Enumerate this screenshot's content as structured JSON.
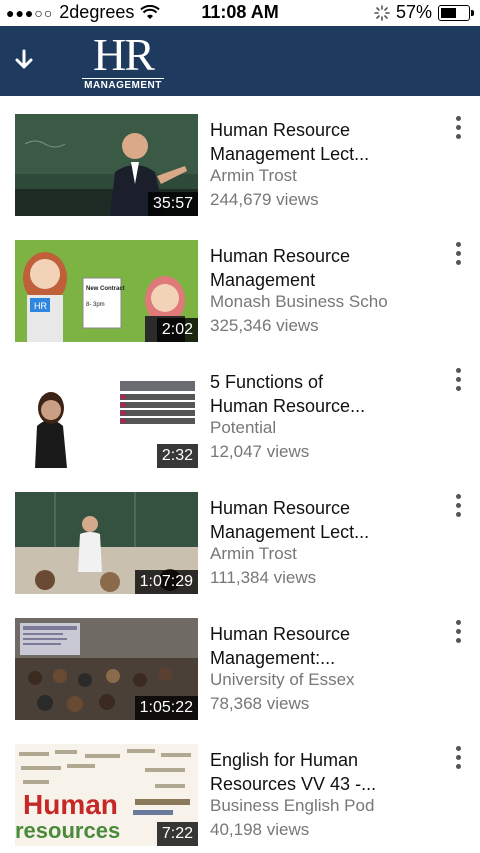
{
  "status_bar": {
    "signal_dots": "●●●○○",
    "carrier": "2degrees",
    "wifi_icon": "wifi-icon",
    "time": "11:08 AM",
    "activity_icon": "activity-spinner-icon",
    "battery_percent_text": "57%",
    "battery_level": 0.57
  },
  "header": {
    "back_icon": "arrow-down-icon",
    "logo_main": "HR",
    "logo_sub": "MANAGEMENT",
    "background_color": "#1f3a5f"
  },
  "videos": [
    {
      "title_line1": "Human Resource",
      "title_line2": "Management Lect...",
      "channel": "Armin Trost",
      "views": "244,679 views",
      "duration": "35:57"
    },
    {
      "title_line1": "Human Resource",
      "title_line2": "Management",
      "channel": "Monash Business Scho",
      "views": "325,346 views",
      "duration": "2:02"
    },
    {
      "title_line1": "5 Functions of",
      "title_line2": "Human Resource...",
      "channel": "Potential",
      "views": "12,047 views",
      "duration": "2:32"
    },
    {
      "title_line1": "Human Resource",
      "title_line2": "Management Lect...",
      "channel": "Armin Trost",
      "views": "111,384 views",
      "duration": "1:07:29"
    },
    {
      "title_line1": "Human Resource",
      "title_line2": "Management:...",
      "channel": "University of Essex",
      "views": "78,368 views",
      "duration": "1:05:22"
    },
    {
      "title_line1": "English for Human",
      "title_line2": "Resources VV 43 -...",
      "channel": "Business English Pod",
      "views": "40,198 views",
      "duration": "7:22"
    }
  ],
  "thumbnail_texts": {
    "contract_title": "New Contract",
    "contract_hours": "8- 3pm",
    "badge": "HR",
    "word_cloud_main": "Human",
    "word_cloud_second": "resources"
  }
}
